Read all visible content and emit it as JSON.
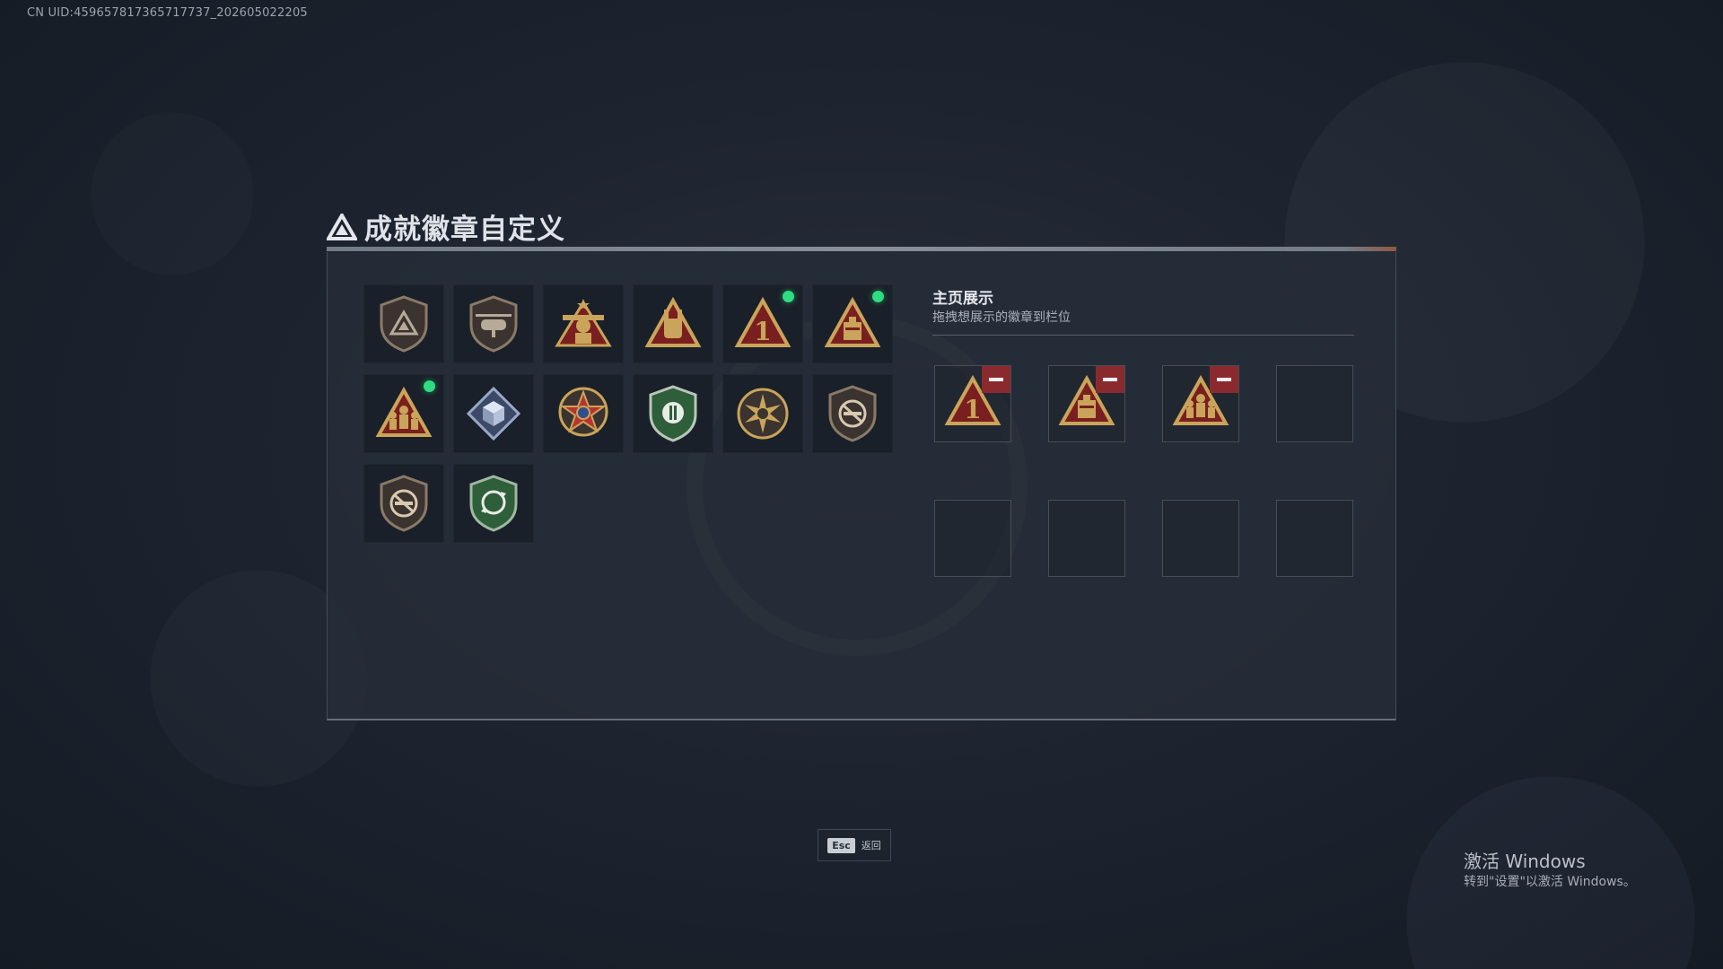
{
  "uid_text": "CN UID:459657817365717737_202605022205",
  "page_title": "成就徽章自定义",
  "badges": [
    {
      "icon": "triangle-shield-badge-icon",
      "new": false
    },
    {
      "icon": "helicopter-shield-badge-icon",
      "new": false
    },
    {
      "icon": "soldier-star-badge-icon",
      "new": false
    },
    {
      "icon": "rock-hand-triangle-badge-icon",
      "new": false
    },
    {
      "icon": "number-one-triangle-badge-icon",
      "new": true
    },
    {
      "icon": "supply-crate-triangle-badge-icon",
      "new": true
    },
    {
      "icon": "squad-triangle-badge-icon",
      "new": true
    },
    {
      "icon": "cube-diamond-badge-icon",
      "new": false
    },
    {
      "icon": "medal-star-badge-icon",
      "new": false
    },
    {
      "icon": "green-shield-badge-icon",
      "new": false
    },
    {
      "icon": "sunburst-medal-badge-icon",
      "new": false
    },
    {
      "icon": "no-gun-shield-badge-icon",
      "new": false
    },
    {
      "icon": "no-gun-shield-badge-icon",
      "new": false
    },
    {
      "icon": "recycle-green-shield-badge-icon",
      "new": false
    }
  ],
  "showcase": {
    "title": "主页展示",
    "subtitle": "拖拽想展示的徽章到栏位",
    "slots": [
      {
        "badge": "number-one-triangle-badge-icon"
      },
      {
        "badge": "supply-crate-triangle-badge-icon"
      },
      {
        "badge": "squad-triangle-badge-icon"
      },
      {
        "badge": null
      },
      {
        "badge": null
      },
      {
        "badge": null
      },
      {
        "badge": null
      },
      {
        "badge": null
      }
    ]
  },
  "footer": {
    "key_label": "Esc",
    "action_label": "返回"
  },
  "windows_watermark": {
    "title": "激活 Windows",
    "subtitle": "转到\"设置\"以激活 Windows。"
  },
  "colors": {
    "gold": "#c9a45a",
    "dark_red": "#7a1f1f",
    "new_dot": "#2fdc83",
    "remove": "#8b2a2e"
  }
}
